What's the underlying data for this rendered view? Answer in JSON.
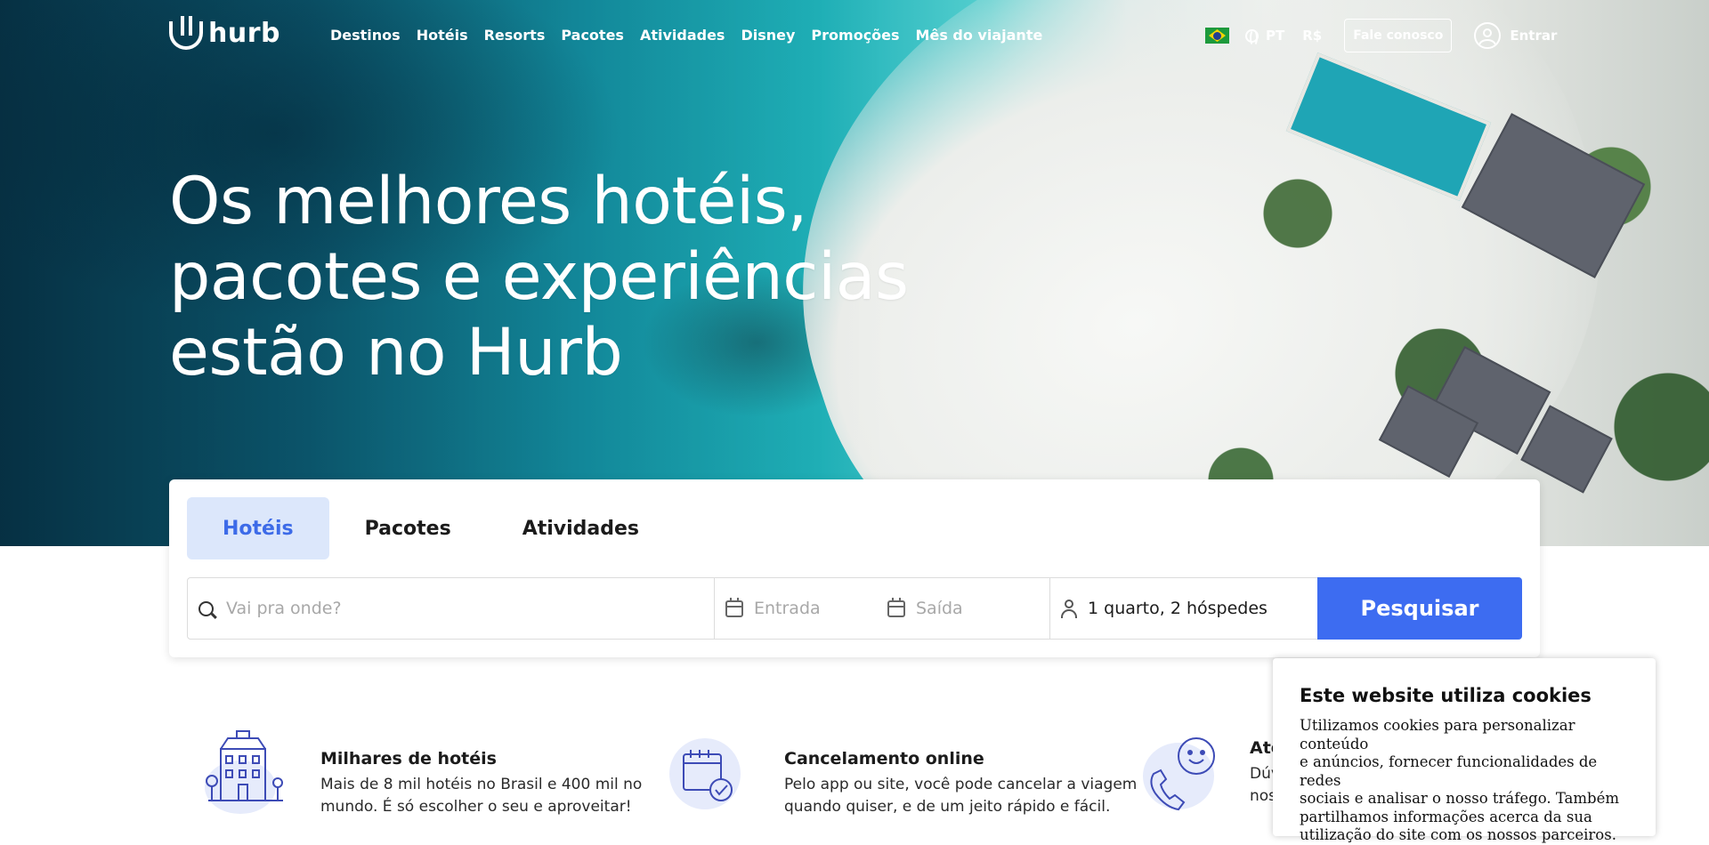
{
  "header": {
    "logo_text": "hurb",
    "nav": [
      "Destinos",
      "Hotéis",
      "Resorts",
      "Pacotes",
      "Atividades",
      "Disney",
      "Promoções",
      "Mês do viajante"
    ],
    "language": "PT",
    "currency": "R$",
    "contact_label": "Fale conosco",
    "login_label": "Entrar"
  },
  "hero": {
    "headline_line1": "Os melhores hotéis,",
    "headline_line2": "pacotes e experiências",
    "headline_line3": "estão no Hurb"
  },
  "search": {
    "tabs": [
      "Hotéis",
      "Pacotes",
      "Atividades"
    ],
    "active_tab": "Hotéis",
    "destination_placeholder": "Vai pra onde?",
    "checkin_placeholder": "Entrada",
    "checkout_placeholder": "Saída",
    "guests_value": "1 quarto, 2 hóspedes",
    "submit_label": "Pesquisar",
    "accent_color": "#3d6cf1"
  },
  "features": [
    {
      "title": "Milhares de hotéis",
      "line1": "Mais de 8 mil hotéis no Brasil e 400 mil no",
      "line2": "mundo. É só escolher o seu e aproveitar!"
    },
    {
      "title": "Cancelamento online",
      "line1": "Pelo app ou site, você pode cancelar a viagem",
      "line2": "quando quiser, e de um jeito rápido e fácil."
    },
    {
      "title": "Ate",
      "line1": "Dúv",
      "line2": "nos"
    }
  ],
  "cookie": {
    "title": "Este website utiliza cookies",
    "line1": "Utilizamos cookies para personalizar conteúdo",
    "line2": "e anúncios, fornecer funcionalidades de redes",
    "line3": "sociais e analisar o nosso tráfego. Também",
    "line4": "partilhamos informações acerca da sua",
    "line5": "utilização do site com os nossos parceiros."
  }
}
